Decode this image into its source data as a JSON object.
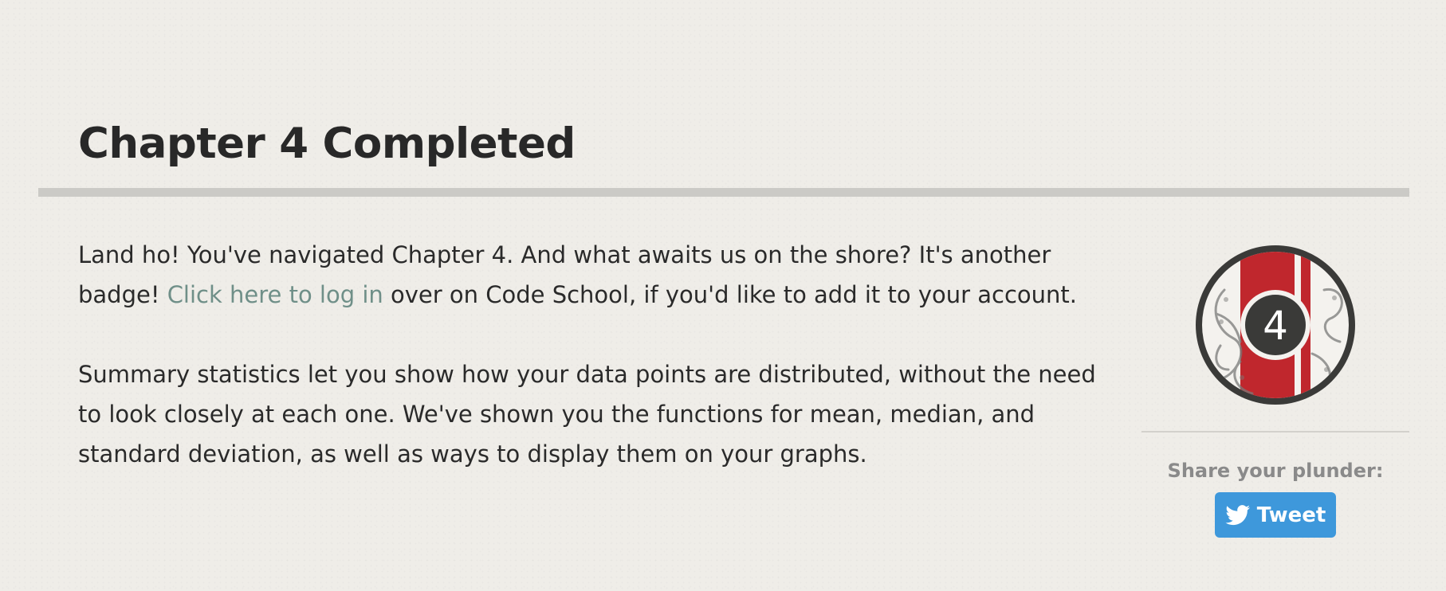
{
  "page": {
    "title": "Chapter 4 Completed"
  },
  "content": {
    "p1_before_link": "Land ho! You've navigated Chapter 4. And what awaits us on the shore? It's another badge! ",
    "p1_link": "Click here to log in",
    "p1_after_link": " over on Code School, if you'd like to add it to your account.",
    "p2": "Summary statistics let you show how your data points are distributed, without the need to look closely at each one. We've shown you the functions for mean, median, and standard deviation, as well as ways to display them on your graphs."
  },
  "sidebar": {
    "badge_number": "4",
    "share_label": "Share your plunder:",
    "tweet_label": "Tweet",
    "tweet_icon": "twitter-bird-icon"
  },
  "colors": {
    "background": "#efede8",
    "link": "#6f8f88",
    "rule": "#cbcac6",
    "badge_red": "#c0272d",
    "badge_dark": "#3a3a38",
    "tweet_blue": "#3e98db"
  }
}
